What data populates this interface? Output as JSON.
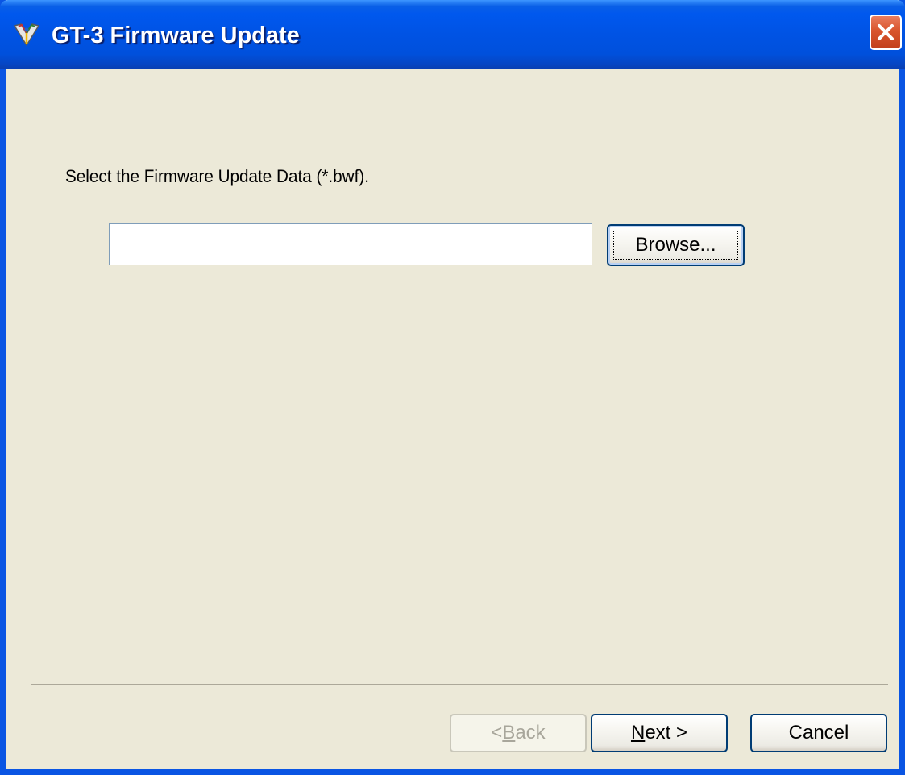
{
  "window": {
    "title": "GT-3 Firmware Update",
    "icon": "app-icon",
    "close_icon": "close-icon"
  },
  "content": {
    "instruction": "Select the Firmware Update Data (*.bwf).",
    "file_input": {
      "value": "",
      "placeholder": ""
    },
    "browse_label": "Browse..."
  },
  "footer": {
    "back": {
      "prefix": "< ",
      "accel": "B",
      "rest": "ack",
      "enabled": false
    },
    "next": {
      "accel": "N",
      "rest": "ext >"
    },
    "cancel_label": "Cancel"
  },
  "colors": {
    "titlebar": "#0053e4",
    "window_bg": "#ece9d8",
    "close_button": "#d9552d",
    "button_border": "#003c74",
    "disabled_text": "#a8a69b"
  }
}
